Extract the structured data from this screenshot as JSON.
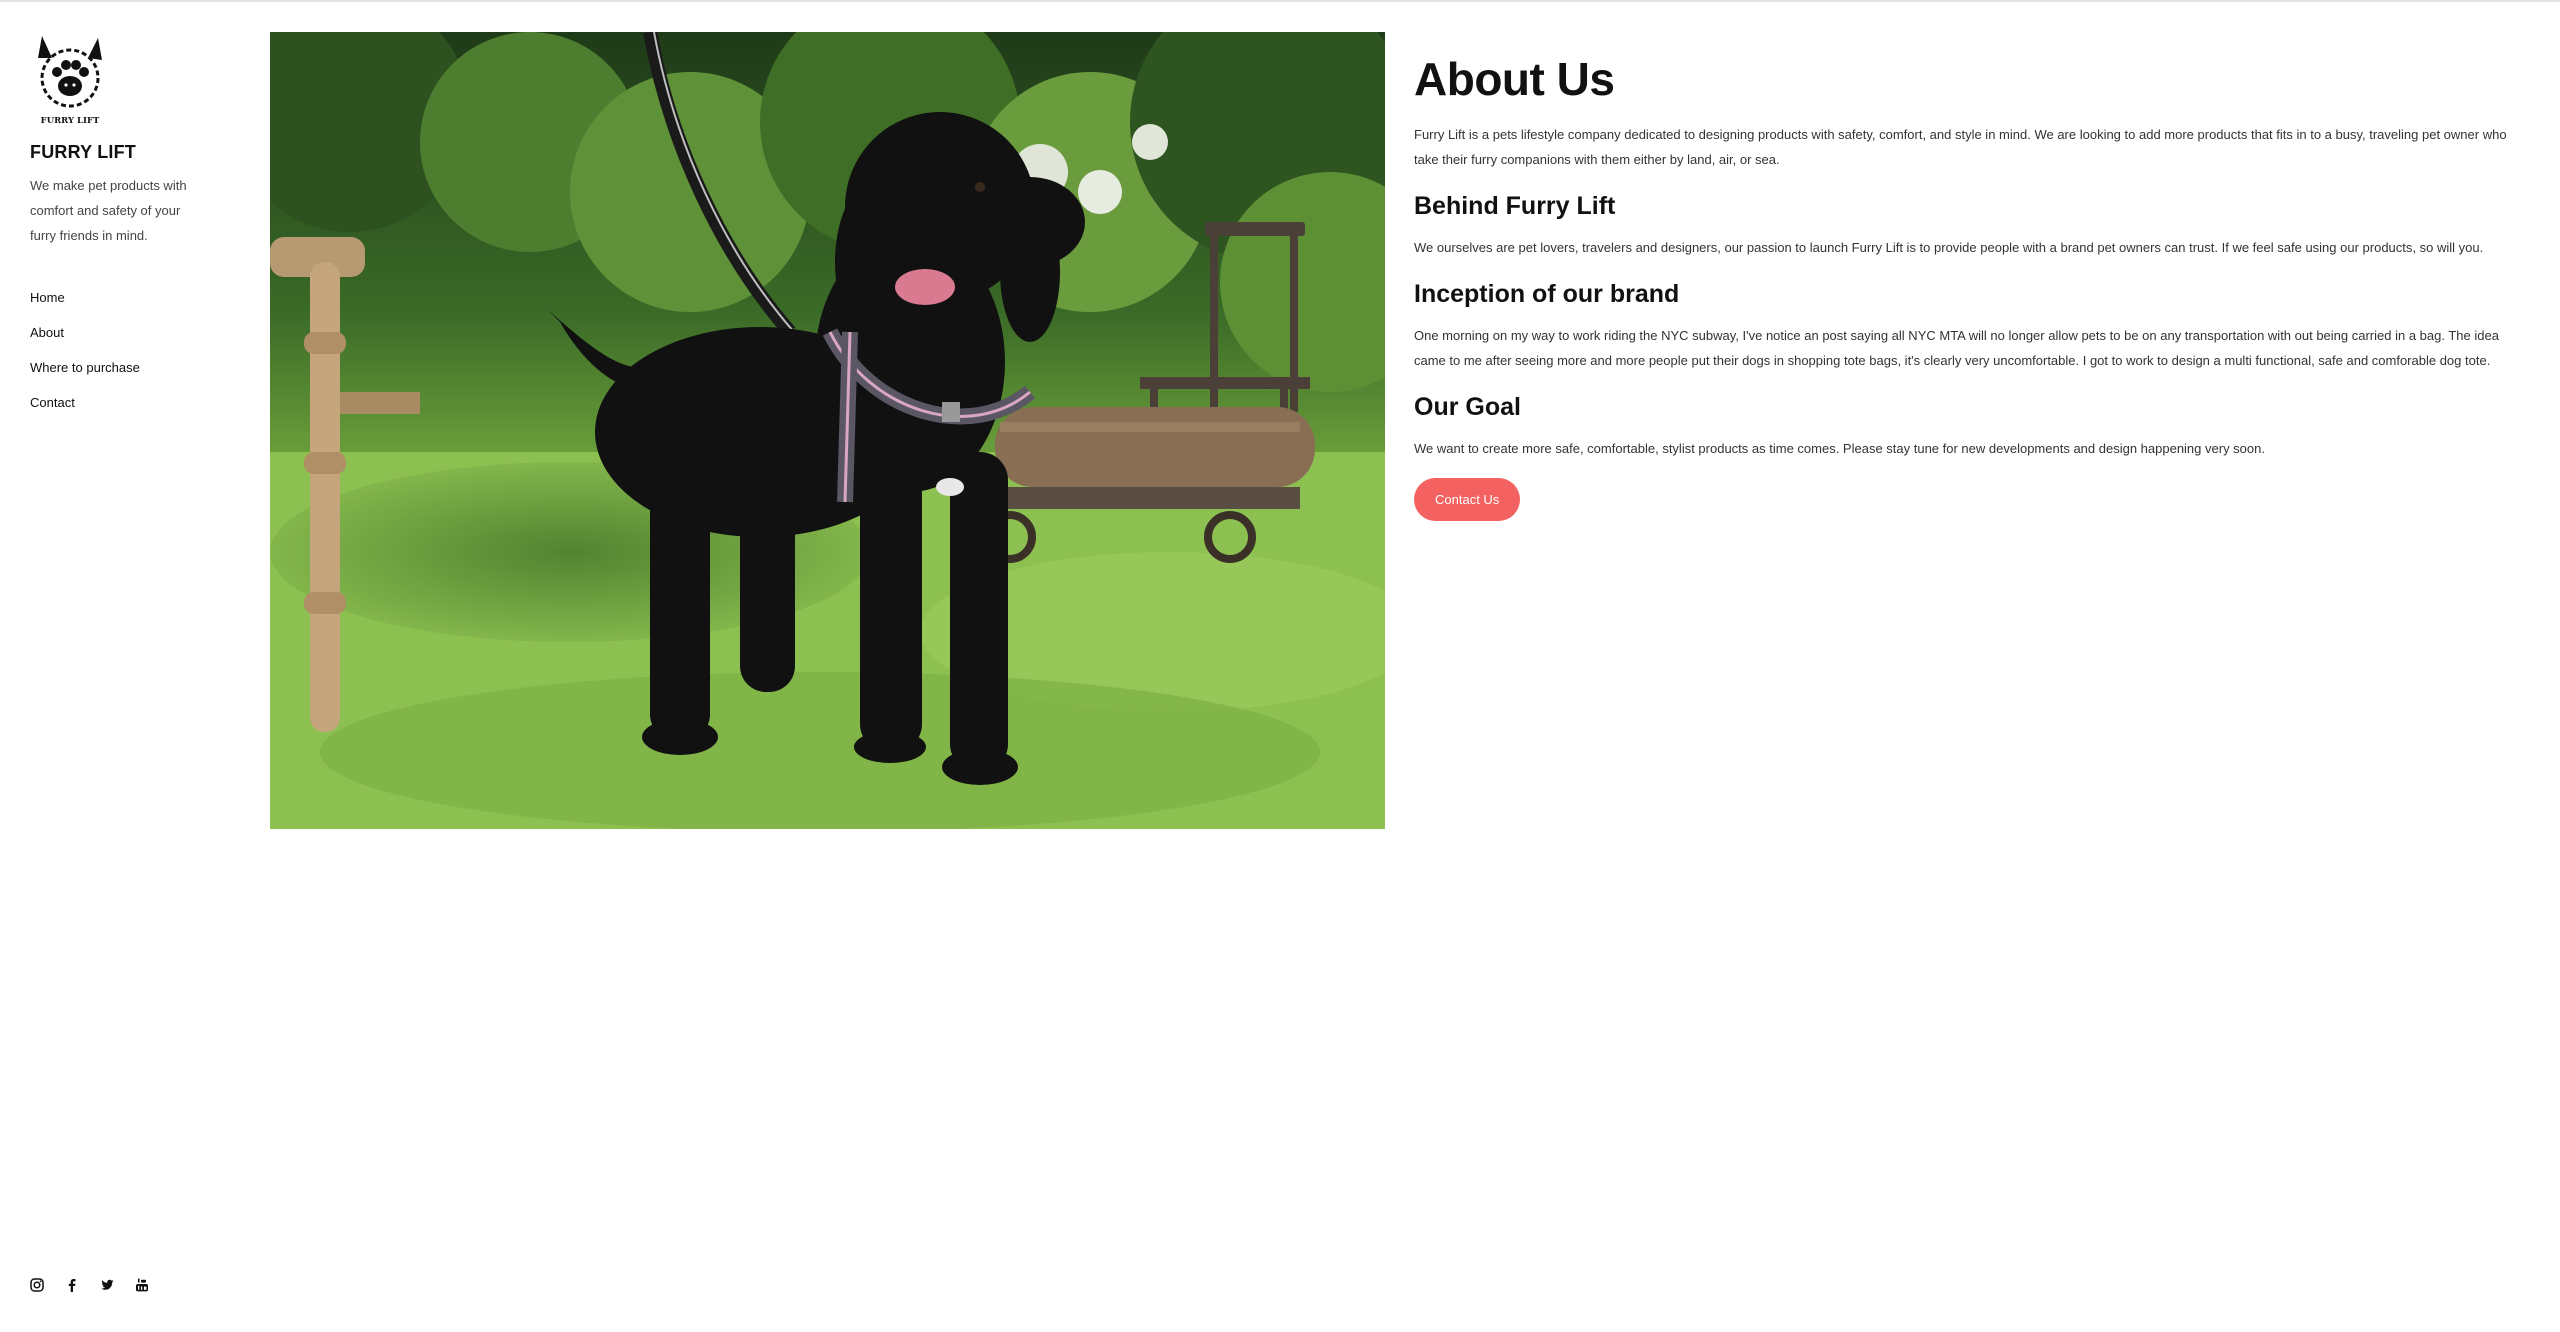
{
  "site": {
    "brand_name": "FURRY LIFT",
    "logo_text": "FURRY LIFT",
    "tagline": "We make pet products with comfort and safety of your furry friends in mind."
  },
  "nav": {
    "items": [
      {
        "label": "Home"
      },
      {
        "label": "About"
      },
      {
        "label": "Where to purchase"
      },
      {
        "label": "Contact"
      }
    ]
  },
  "social": {
    "icons": [
      "instagram-icon",
      "facebook-icon",
      "twitter-icon",
      "youtube-icon"
    ]
  },
  "hero": {
    "subject": "black poodle dog with harness and leash standing on grass in a garden"
  },
  "about": {
    "title": "About Us",
    "intro": "Furry Lift is a pets lifestyle company dedicated to designing products with safety, comfort, and style in mind. We are looking to add more products that fits in to a busy, traveling pet owner who take their furry companions with them either by land, air, or sea.",
    "sections": [
      {
        "heading": "Behind Furry Lift",
        "text": "We ourselves are pet lovers, travelers and designers, our passion to launch Furry Lift is to provide people with a brand pet owners can trust. If we feel safe using our products, so will you."
      },
      {
        "heading": "Inception of our brand",
        "text": "One morning on my way to work riding the NYC subway, I've notice an post saying all NYC MTA will no longer allow pets to be on any transportation with out being carried in a bag. The idea came to me after seeing more and more people put their dogs in shopping tote bags, it's clearly very uncomfortable. I got to work to design a multi functional, safe and comforable dog tote."
      },
      {
        "heading": "Our Goal",
        "text": "We want to create more safe, comfortable, stylist products as time comes. Please stay tune for new developments and design happening very soon."
      }
    ],
    "cta_label": "Contact Us"
  },
  "colors": {
    "accent": "#f36160",
    "text": "#111111",
    "body_text": "#333333"
  }
}
